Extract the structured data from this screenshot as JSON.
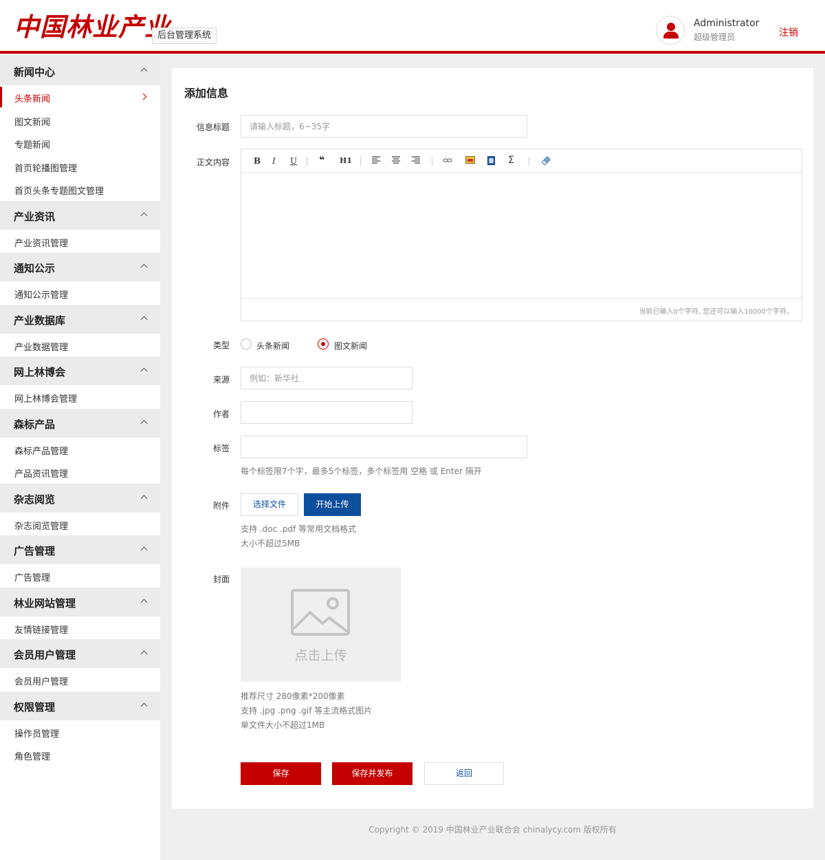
{
  "header": {
    "logo_text": "中国林业产业",
    "system_name": "后台管理系统",
    "user_name": "Administrator",
    "user_role": "超级管理员",
    "logout_label": "注销"
  },
  "sidebar": {
    "groups": [
      {
        "title": "新闻中心",
        "items": [
          "头条新闻",
          "图文新闻",
          "专题新闻",
          "首页轮播图管理",
          "首页头条专题图文管理"
        ]
      },
      {
        "title": "产业资讯",
        "items": [
          "产业资讯管理"
        ]
      },
      {
        "title": "通知公示",
        "items": [
          "通知公示管理"
        ]
      },
      {
        "title": "产业数据库",
        "items": [
          "产业数据管理"
        ]
      },
      {
        "title": "网上林博会",
        "items": [
          "网上林博会管理"
        ]
      },
      {
        "title": "森标产品",
        "items": [
          "森标产品管理",
          "产品资讯管理"
        ]
      },
      {
        "title": "杂志阅览",
        "items": [
          "杂志阅览管理"
        ]
      },
      {
        "title": "广告管理",
        "items": [
          "广告管理"
        ]
      },
      {
        "title": "林业网站管理",
        "items": [
          "友情链接管理"
        ]
      },
      {
        "title": "会员用户管理",
        "items": [
          "会员用户管理"
        ]
      },
      {
        "title": "权限管理",
        "items": [
          "操作员管理",
          "角色管理"
        ]
      }
    ],
    "active_item": "头条新闻"
  },
  "form": {
    "title": "添加信息",
    "headline_label": "信息标题",
    "headline_placeholder": "请输入标题，6~35字",
    "content_label": "正文内容",
    "editor_counter": "当前已输入0个字符, 您还可以输入10000个字符。",
    "type_label": "类型",
    "type_options": [
      "头条新闻",
      "图文新闻"
    ],
    "type_selected": "图文新闻",
    "source_label": "来源",
    "source_placeholder": "例如：新华社",
    "author_label": "作者",
    "tags_label": "标签",
    "tags_hint": "每个标签限7个字，最多5个标签，多个标签用 空格 或 Enter 隔开",
    "attachment_label": "附件",
    "choose_file_label": "选择文件",
    "start_upload_label": "开始上传",
    "attachment_hint1": "支持 .doc .pdf 等常用文档格式",
    "attachment_hint2": "大小不超过5MB",
    "cover_label": "封面",
    "cover_upload_text": "点击上传",
    "cover_hint1": "推荐尺寸 280像素*200像素",
    "cover_hint2": "支持 .jpg .png .gif 等主流格式图片",
    "cover_hint3": "单文件大小不超过1MB",
    "save_label": "保存",
    "save_publish_label": "保存并发布",
    "back_label": "返回"
  },
  "toolbar": {
    "bold": "B",
    "italic": "I",
    "underline": "U",
    "quote": "❝",
    "heading": "H1",
    "formula": "Σ"
  },
  "footer": {
    "copyright": "Copyright © 2019 中国林业产业联合会 chinalycy.com 版权所有"
  },
  "colors": {
    "accent": "#c40000",
    "primary_button": "#0c4f9d",
    "group_bg": "#ebebeb",
    "page_bg": "#efefef"
  }
}
